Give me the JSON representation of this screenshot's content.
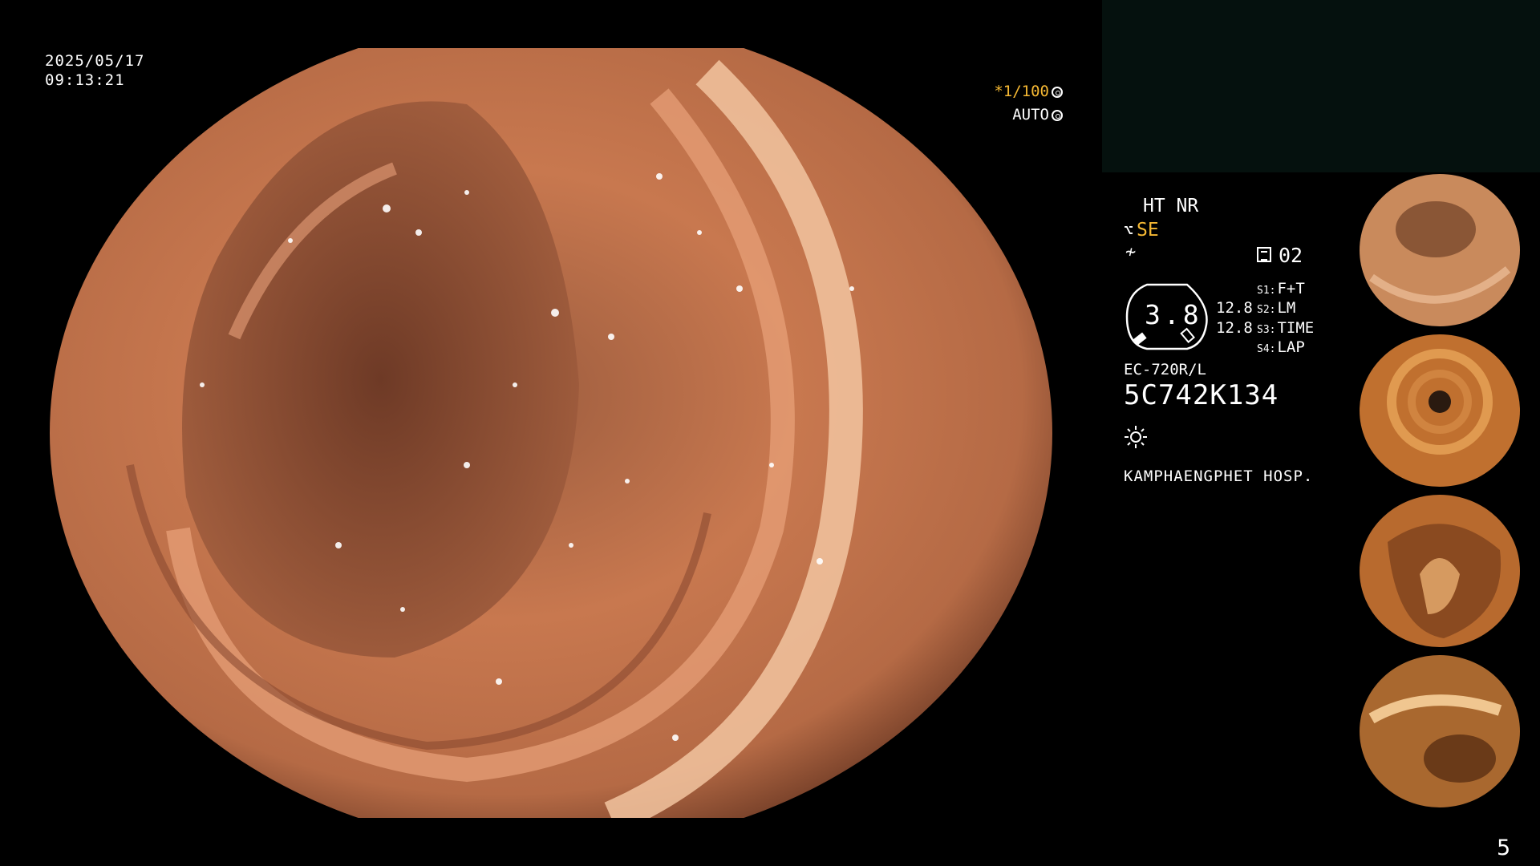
{
  "overlay": {
    "date": "2025/05/17",
    "time": "09:13:21",
    "shutter_speed": "*1/100",
    "iris_mode": "AUTO"
  },
  "settings": {
    "ht_nr": "HT NR",
    "se_label": "SE",
    "monitor_value": "02",
    "gauge_value": "3.8",
    "value_top": "12.8",
    "value_bottom": "12.8",
    "slots": [
      {
        "key": "S1:",
        "label": "F+T"
      },
      {
        "key": "S2:",
        "label": "LM"
      },
      {
        "key": "S3:",
        "label": "TIME"
      },
      {
        "key": "S4:",
        "label": "LAP"
      }
    ]
  },
  "scope": {
    "model": "EC-720R/L",
    "serial": "5C742K134"
  },
  "hospital": "KAMPHAENGPHET HOSP.",
  "page_number": "5",
  "icons": [
    "se-scope-icon",
    "slash-icon",
    "monitor-icon",
    "sun-icon",
    "iris-icon",
    "aperture-icon"
  ],
  "colors": {
    "accent_yellow": "#f5b833",
    "background": "#000000",
    "mucosa": "#c0704a"
  }
}
